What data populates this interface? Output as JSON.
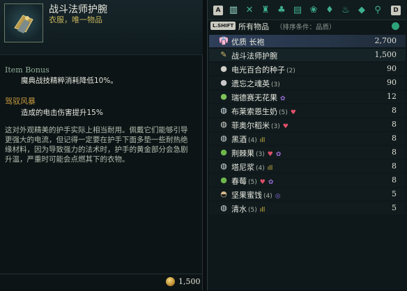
{
  "tooltip": {
    "title": "战斗法师护腕",
    "subtitle": "衣服，唯一物品",
    "bonus_heading": "Item Bonus",
    "bonus_text": "魔典战技精粹消耗降低10%。",
    "ability_heading": "驾驭风暴",
    "ability_text": "造成的电击伤害提升15%",
    "description": "这对外观精美的护手实际上相当耐用。佩戴它们能够引导更强大的电流，但记得一定要在护手下面多垫一些耐热绝缘材料，因为导致强力的法术时，护手的黄金部分会急剧升温，严重时可能会点燃其下的衣物。",
    "price": "1,500",
    "thumb_icon": "bracers-icon"
  },
  "inventory": {
    "keys": {
      "left": "A",
      "right": "D",
      "shift": "L.SHIFT"
    },
    "tabs": [
      {
        "name": "all-items",
        "glyph": "▥",
        "active": true
      },
      {
        "name": "weapons",
        "glyph": "✕"
      },
      {
        "name": "armor",
        "glyph": "♜"
      },
      {
        "name": "accessories",
        "glyph": "♣"
      },
      {
        "name": "grimoire",
        "glyph": "▤"
      },
      {
        "name": "ingredients",
        "glyph": "❀"
      },
      {
        "name": "gifts",
        "glyph": "♦"
      },
      {
        "name": "lamps",
        "glyph": "♨"
      },
      {
        "name": "gems",
        "glyph": "◆"
      },
      {
        "name": "keys",
        "glyph": "⚲"
      }
    ],
    "category_label": "所有物品",
    "sort_label": "（排序条件：品质）",
    "items": [
      {
        "name": "优质 长袍",
        "qty": "",
        "value": "2,700",
        "icon": "robe-icon",
        "icon_color": "#d2d8e6",
        "glyph": "👘",
        "badges": []
      },
      {
        "name": "战斗法师护腕",
        "qty": "",
        "value": "1,500",
        "icon": "bracers-icon",
        "icon_color": "#d7c26e",
        "glyph": "✎",
        "badges": []
      },
      {
        "name": "电光百合的种子",
        "qty": "(2)",
        "value": "90",
        "icon": "seed-icon",
        "icon_color": "#cfd0c8",
        "glyph": "●",
        "badges": []
      },
      {
        "name": "遗忘之魂英",
        "qty": "(3)",
        "value": "90",
        "icon": "soul-flower-icon",
        "icon_color": "#c9c9c9",
        "glyph": "●",
        "badges": []
      },
      {
        "name": "瑞德赛无花果",
        "qty": "",
        "value": "12",
        "icon": "fig-icon",
        "icon_color": "#7fc25a",
        "glyph": "●",
        "badges": [
          {
            "type": "gift",
            "glyph": "✿",
            "color": "#9a6fd8"
          }
        ]
      },
      {
        "name": "布莱索恩生奶",
        "qty": "(5)",
        "value": "8",
        "icon": "milk-icon",
        "icon_color": "#d6e6f0",
        "glyph": "◍",
        "badges": [
          {
            "type": "heart",
            "glyph": "♥",
            "color": "#e0506a"
          }
        ]
      },
      {
        "name": "菲奥尔稻米",
        "qty": "(3)",
        "value": "8",
        "icon": "rice-icon",
        "icon_color": "#d8d8cf",
        "glyph": "◍",
        "badges": [
          {
            "type": "heart",
            "glyph": "♥",
            "color": "#e0506a"
          }
        ]
      },
      {
        "name": "黑酒",
        "qty": "(4)",
        "value": "8",
        "icon": "dark-wine-icon",
        "icon_color": "#d6dde0",
        "glyph": "◍",
        "badges": [
          {
            "type": "fire",
            "glyph": "ıll",
            "color": "#e0c34a"
          }
        ]
      },
      {
        "name": "荆棘果",
        "qty": "(3)",
        "value": "8",
        "icon": "thornberry-icon",
        "icon_color": "#6db84c",
        "glyph": "●",
        "badges": [
          {
            "type": "heart",
            "glyph": "♥",
            "color": "#e0506a"
          },
          {
            "type": "gift",
            "glyph": "✿",
            "color": "#9a6fd8"
          }
        ]
      },
      {
        "name": "塔尼浆",
        "qty": "(4)",
        "value": "8",
        "icon": "tani-juice-icon",
        "icon_color": "#d6dde0",
        "glyph": "◍",
        "badges": [
          {
            "type": "fire",
            "glyph": "ıll",
            "color": "#e0c34a"
          }
        ]
      },
      {
        "name": "春莓",
        "qty": "(5)",
        "value": "8",
        "icon": "spring-berry-icon",
        "icon_color": "#6db84c",
        "glyph": "●",
        "badges": [
          {
            "type": "heart",
            "glyph": "♥",
            "color": "#e0506a"
          },
          {
            "type": "gift",
            "glyph": "✿",
            "color": "#9a6fd8"
          }
        ]
      },
      {
        "name": "坚果蜜饯",
        "qty": "(4)",
        "value": "5",
        "icon": "candied-nuts-icon",
        "icon_color": "#d8b98a",
        "glyph": "◓",
        "badges": [
          {
            "type": "magic",
            "glyph": "◎",
            "color": "#8b6fe0"
          }
        ]
      },
      {
        "name": "清水",
        "qty": "(5)",
        "value": "5",
        "icon": "water-icon",
        "icon_color": "#d6dde0",
        "glyph": "◍",
        "badges": [
          {
            "type": "fire",
            "glyph": "ıll",
            "color": "#e0c34a"
          }
        ]
      }
    ]
  }
}
